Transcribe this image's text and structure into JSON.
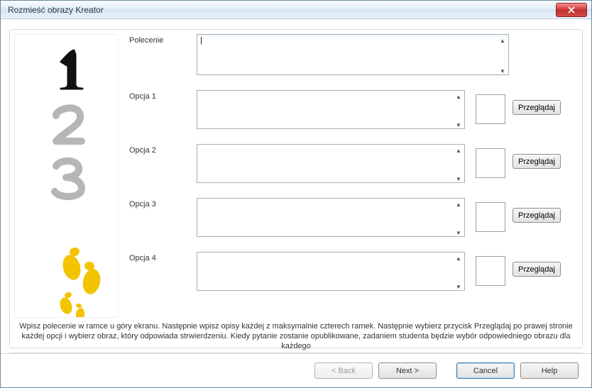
{
  "window": {
    "title": "Rozmieść obrazy Kreator"
  },
  "labels": {
    "prompt": "Polecenie",
    "option1": "Opcja 1",
    "option2": "Opcja 2",
    "option3": "Opcja 3",
    "option4": "Opcja 4"
  },
  "values": {
    "prompt": "|",
    "option1": "",
    "option2": "",
    "option3": "",
    "option4": ""
  },
  "buttons": {
    "browse": "Przeglądaj",
    "back": "< Back",
    "next": "Next >",
    "cancel": "Cancel",
    "help": "Help"
  },
  "instructions": "Wpisz polecenie w ramce u góry ekranu. Następnie wpisz opisy każdej z maksymalnie czterech ramek. Następnie wybierz przycisk Przeglądaj po prawej stronie każdej opcji i wybierz obraz, który odpowiada strwierdzeniu. Kiedy pytanie zostanie opublikowane, zadaniem studenta będzie wybór odpowiedniego obrazu dla każdego"
}
